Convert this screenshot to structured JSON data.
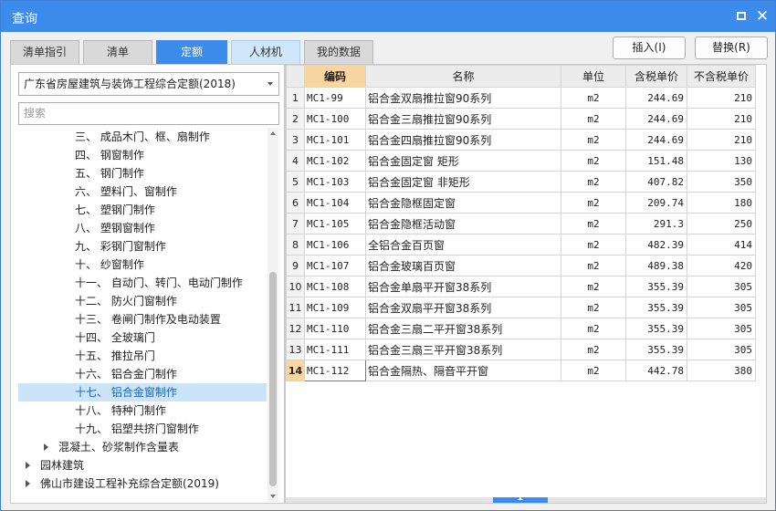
{
  "window": {
    "title": "查询"
  },
  "tabs": [
    "清单指引",
    "清单",
    "定额",
    "人材机",
    "我的数据"
  ],
  "buttons": {
    "insert": "插入(I)",
    "replace": "替换(R)"
  },
  "left": {
    "selected_book": "广东省房屋建筑与装饰工程综合定额(2018)",
    "search_placeholder": "搜索",
    "tree": [
      {
        "label": "三、  成品木门、框、扇制作"
      },
      {
        "label": "四、  钢窗制作"
      },
      {
        "label": "五、  钢门制作"
      },
      {
        "label": "六、  塑料门、窗制作"
      },
      {
        "label": "七、  塑钢门制作"
      },
      {
        "label": "八、  塑钢窗制作"
      },
      {
        "label": "九、  彩钢门窗制作"
      },
      {
        "label": "十、  纱窗制作"
      },
      {
        "label": "十一、  自动门、转门、电动门制作"
      },
      {
        "label": "十二、  防火门窗制作"
      },
      {
        "label": "十三、  卷闸门制作及电动装置"
      },
      {
        "label": "十四、  全玻璃门"
      },
      {
        "label": "十五、  推拉吊门"
      },
      {
        "label": "十六、  铝合金门制作"
      },
      {
        "label": "十七、  铝合金窗制作"
      },
      {
        "label": "十八、  特种门制作"
      },
      {
        "label": "十九、  铝塑共挤门窗制作"
      },
      {
        "label": "混凝土、砂浆制作含量表"
      },
      {
        "label": "园林建筑"
      },
      {
        "label": "佛山市建设工程补充综合定额(2019)"
      }
    ]
  },
  "table": {
    "columns": [
      "",
      "编码",
      "名称",
      "单位",
      "含税单价",
      "不含税单价"
    ],
    "rows": [
      {
        "n": "1",
        "code": "MC1-99",
        "name": "铝合金双扇推拉窗90系列",
        "unit": "m2",
        "tax_price": "244.69",
        "price": "210"
      },
      {
        "n": "2",
        "code": "MC1-100",
        "name": "铝合金三扇推拉窗90系列",
        "unit": "m2",
        "tax_price": "244.69",
        "price": "210"
      },
      {
        "n": "3",
        "code": "MC1-101",
        "name": "铝合金四扇推拉窗90系列",
        "unit": "m2",
        "tax_price": "244.69",
        "price": "210"
      },
      {
        "n": "4",
        "code": "MC1-102",
        "name": "铝合金固定窗  矩形",
        "unit": "m2",
        "tax_price": "151.48",
        "price": "130"
      },
      {
        "n": "5",
        "code": "MC1-103",
        "name": "铝合金固定窗  非矩形",
        "unit": "m2",
        "tax_price": "407.82",
        "price": "350"
      },
      {
        "n": "6",
        "code": "MC1-104",
        "name": "铝合金隐框固定窗",
        "unit": "m2",
        "tax_price": "209.74",
        "price": "180"
      },
      {
        "n": "7",
        "code": "MC1-105",
        "name": "铝合金隐框活动窗",
        "unit": "m2",
        "tax_price": "291.3",
        "price": "250"
      },
      {
        "n": "8",
        "code": "MC1-106",
        "name": "全铝合金百页窗",
        "unit": "m2",
        "tax_price": "482.39",
        "price": "414"
      },
      {
        "n": "9",
        "code": "MC1-107",
        "name": "铝合金玻璃百页窗",
        "unit": "m2",
        "tax_price": "489.38",
        "price": "420"
      },
      {
        "n": "10",
        "code": "MC1-108",
        "name": "铝合金单扇平开窗38系列",
        "unit": "m2",
        "tax_price": "355.39",
        "price": "305"
      },
      {
        "n": "11",
        "code": "MC1-109",
        "name": "铝合金双扇平开窗38系列",
        "unit": "m2",
        "tax_price": "355.39",
        "price": "305"
      },
      {
        "n": "12",
        "code": "MC1-110",
        "name": "铝合金三扇二平开窗38系列",
        "unit": "m2",
        "tax_price": "355.39",
        "price": "305"
      },
      {
        "n": "13",
        "code": "MC1-111",
        "name": "铝合金三扇三平开窗38系列",
        "unit": "m2",
        "tax_price": "355.39",
        "price": "305"
      },
      {
        "n": "14",
        "code": "MC1-112",
        "name": "铝合金隔热、隔音平开窗",
        "unit": "m2",
        "tax_price": "442.78",
        "price": "380"
      }
    ]
  },
  "colors": {
    "accent": "#3d8bea",
    "selected_bg": "#cce4f7",
    "sorted_header": "#f9d69f"
  }
}
